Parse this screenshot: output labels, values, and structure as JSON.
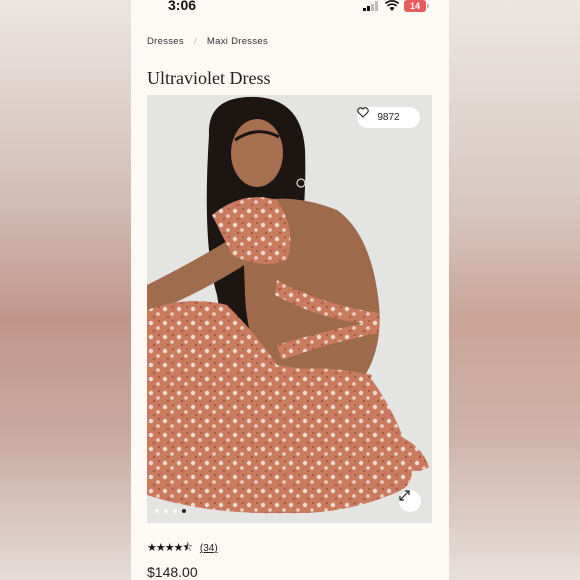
{
  "status_bar": {
    "time": "3:06",
    "battery": "14"
  },
  "breadcrumb": {
    "items": [
      "Dresses",
      "Maxi Dresses"
    ]
  },
  "product": {
    "title": "Ultraviolet Dress",
    "likes": "9872",
    "rating_stars": "★★★★⯪",
    "review_count": "(34)",
    "price": "$148.00",
    "image_count": 4,
    "active_image": 4
  },
  "icons": {
    "heart": "heart-icon",
    "expand": "expand-icon",
    "signal": "signal-icon",
    "wifi": "wifi-icon"
  }
}
